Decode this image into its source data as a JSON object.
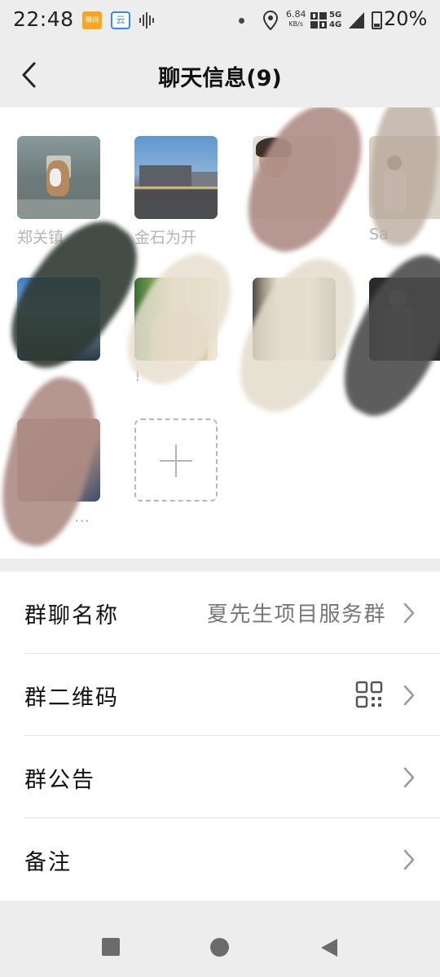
{
  "status_bar": {
    "time": "22:48",
    "net_speed": "6.84",
    "net_unit": "KB/s",
    "net_type_top": "5G",
    "net_type_bottom": "4G",
    "battery": "20%",
    "app_icon_1_text": "瞬间",
    "app_icon_2_text": "云"
  },
  "header": {
    "title": "聊天信息(9)"
  },
  "members": [
    {
      "name": "郑关镇"
    },
    {
      "name": "金石为开"
    },
    {
      "name": ""
    },
    {
      "name": "Sa"
    },
    {
      "name": ""
    },
    {
      "name": "!"
    },
    {
      "name": ""
    },
    {
      "name": ""
    },
    {
      "name": "…"
    }
  ],
  "settings": {
    "group_name_label": "群聊名称",
    "group_name_value": "夏先生项目服务群",
    "qr_label": "群二维码",
    "notice_label": "群公告",
    "remark_label": "备注"
  },
  "colors": {
    "background": "#ededed",
    "panel": "#ffffff",
    "member_name": "#b4b4b4"
  }
}
